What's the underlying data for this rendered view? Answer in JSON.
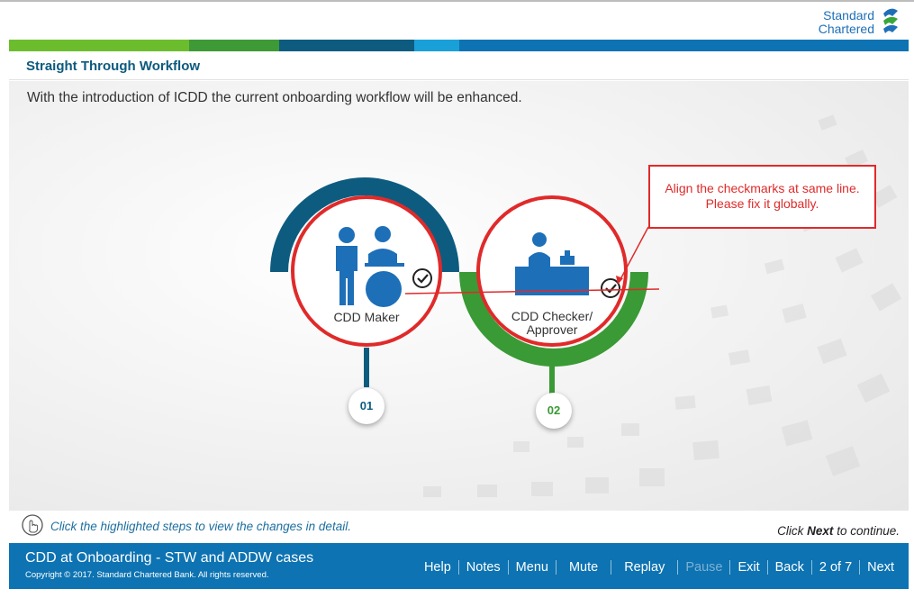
{
  "brand": {
    "line1": "Standard",
    "line2": "Chartered",
    "colors": {
      "blue": "#1d6fb8",
      "green": "#3aa63a"
    }
  },
  "color_bar": [
    "#6cbd2e",
    "#3e9a36",
    "#0d5c80",
    "#1aa0d8",
    "#0d73b2"
  ],
  "page": {
    "title": "Straight Through Workflow",
    "intro": "With the introduction of ICDD the current onboarding workflow will be enhanced."
  },
  "steps": [
    {
      "label": "CDD Maker",
      "number": "01",
      "accent": "#0d5c80",
      "icon": "maker-icon"
    },
    {
      "label_line1": "CDD Checker/",
      "label_line2": "Approver",
      "number": "02",
      "accent": "#3a9a35",
      "icon": "checker-icon"
    }
  ],
  "callout": {
    "line1": "Align the checkmarks at same line.",
    "line2": "Please fix it globally."
  },
  "instructions": {
    "hint": "Click the highlighted steps to view the changes in detail.",
    "continue_prefix": "Click ",
    "continue_bold": "Next",
    "continue_suffix": " to continue."
  },
  "footer": {
    "course_title": "CDD at Onboarding - STW and ADDW cases",
    "copyright": "Copyright © 2017. Standard Chartered Bank. All rights reserved.",
    "nav": {
      "help": "Help",
      "notes": "Notes",
      "menu": "Menu",
      "mute": "Mute",
      "replay": "Replay",
      "pause": "Pause",
      "exit": "Exit",
      "back": "Back",
      "page_counter": "2 of 7",
      "next": "Next"
    }
  }
}
